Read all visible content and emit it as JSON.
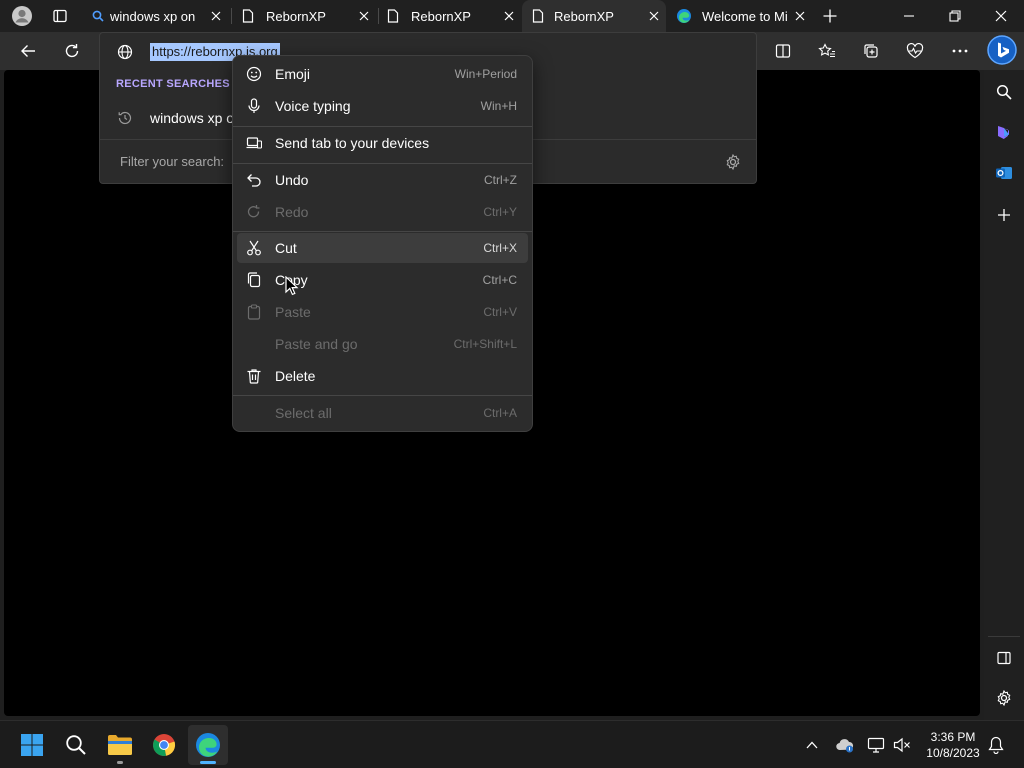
{
  "tabs": [
    {
      "label": "windows xp on",
      "icon": "search-icon",
      "active": false
    },
    {
      "label": "RebornXP",
      "icon": "page-icon",
      "active": false
    },
    {
      "label": "RebornXP",
      "icon": "page-icon",
      "active": false
    },
    {
      "label": "RebornXP",
      "icon": "page-icon",
      "active": true
    },
    {
      "label": "Welcome to Mi",
      "icon": "edge-icon",
      "active": false
    }
  ],
  "address": {
    "url": "https://rebornxp.is.org",
    "recent_heading": "RECENT SEARCHES",
    "recent_item": "windows xp o",
    "filter_placeholder": "Filter your search:"
  },
  "context_menu": {
    "items": [
      {
        "label": "Emoji",
        "shortcut": "Win+Period",
        "icon": "emoji-icon",
        "disabled": false
      },
      {
        "label": "Voice typing",
        "shortcut": "Win+H",
        "icon": "microphone-icon",
        "disabled": false
      },
      {
        "label": "Send tab to your devices",
        "shortcut": "",
        "icon": "devices-icon",
        "disabled": false
      },
      {
        "label": "Undo",
        "shortcut": "Ctrl+Z",
        "icon": "undo-icon",
        "disabled": false
      },
      {
        "label": "Redo",
        "shortcut": "Ctrl+Y",
        "icon": "redo-icon",
        "disabled": true
      },
      {
        "label": "Cut",
        "shortcut": "Ctrl+X",
        "icon": "scissors-icon",
        "disabled": false,
        "highlighted": true
      },
      {
        "label": "Copy",
        "shortcut": "Ctrl+C",
        "icon": "copy-icon",
        "disabled": false
      },
      {
        "label": "Paste",
        "shortcut": "Ctrl+V",
        "icon": "paste-icon",
        "disabled": true
      },
      {
        "label": "Paste and go",
        "shortcut": "Ctrl+Shift+L",
        "icon": "paste-icon",
        "disabled": true
      },
      {
        "label": "Delete",
        "shortcut": "",
        "icon": "trash-icon",
        "disabled": false
      },
      {
        "label": "Select all",
        "shortcut": "Ctrl+A",
        "icon": "",
        "disabled": true
      }
    ]
  },
  "clock": {
    "time": "3:36 PM",
    "date": "10/8/2023"
  },
  "colors": {
    "selection": "#a6c8ff",
    "accent": "#4fb4ff",
    "recent_heading": "#b9a7ff"
  }
}
